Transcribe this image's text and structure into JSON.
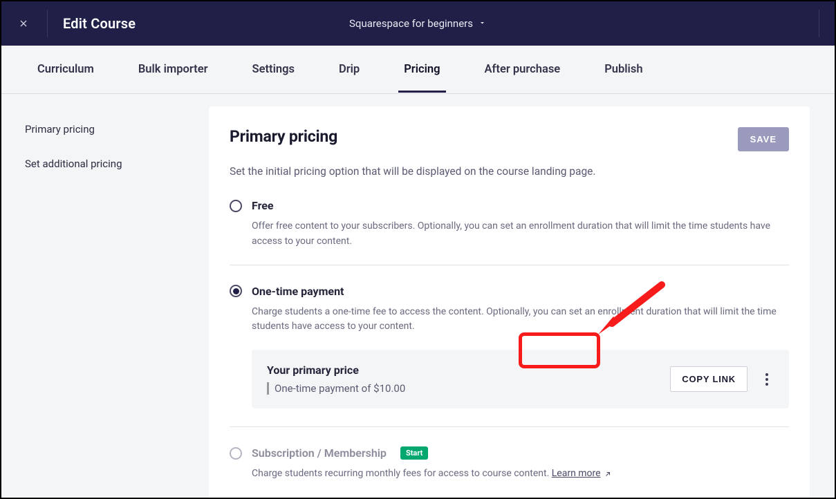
{
  "header": {
    "title": "Edit Course",
    "course_name": "Squarespace for beginners"
  },
  "tabs": [
    {
      "label": "Curriculum",
      "active": false
    },
    {
      "label": "Bulk importer",
      "active": false
    },
    {
      "label": "Settings",
      "active": false
    },
    {
      "label": "Drip",
      "active": false
    },
    {
      "label": "Pricing",
      "active": true
    },
    {
      "label": "After purchase",
      "active": false
    },
    {
      "label": "Publish",
      "active": false
    }
  ],
  "sidenav": {
    "items": [
      {
        "label": "Primary pricing"
      },
      {
        "label": "Set additional pricing"
      }
    ]
  },
  "panel": {
    "title": "Primary pricing",
    "save_label": "SAVE",
    "subtitle": "Set the initial pricing option that will be displayed on the course landing page."
  },
  "options": {
    "free": {
      "label": "Free",
      "desc": "Offer free content to your subscribers. Optionally, you can set an enrollment duration that will limit the time students have access to your content."
    },
    "one_time": {
      "label": "One-time payment",
      "desc": "Charge students a one-time fee to access the content. Optionally, you can set an enrollment duration that will limit the time students have access to your content.",
      "card": {
        "title": "Your primary price",
        "line": "One-time payment of $10.00",
        "copy_label": "COPY LINK"
      }
    },
    "subscription": {
      "label": "Subscription / Membership",
      "badge": "Start",
      "desc_prefix": "Charge students recurring monthly fees for access to course content. ",
      "learn_label": "Learn more"
    }
  }
}
